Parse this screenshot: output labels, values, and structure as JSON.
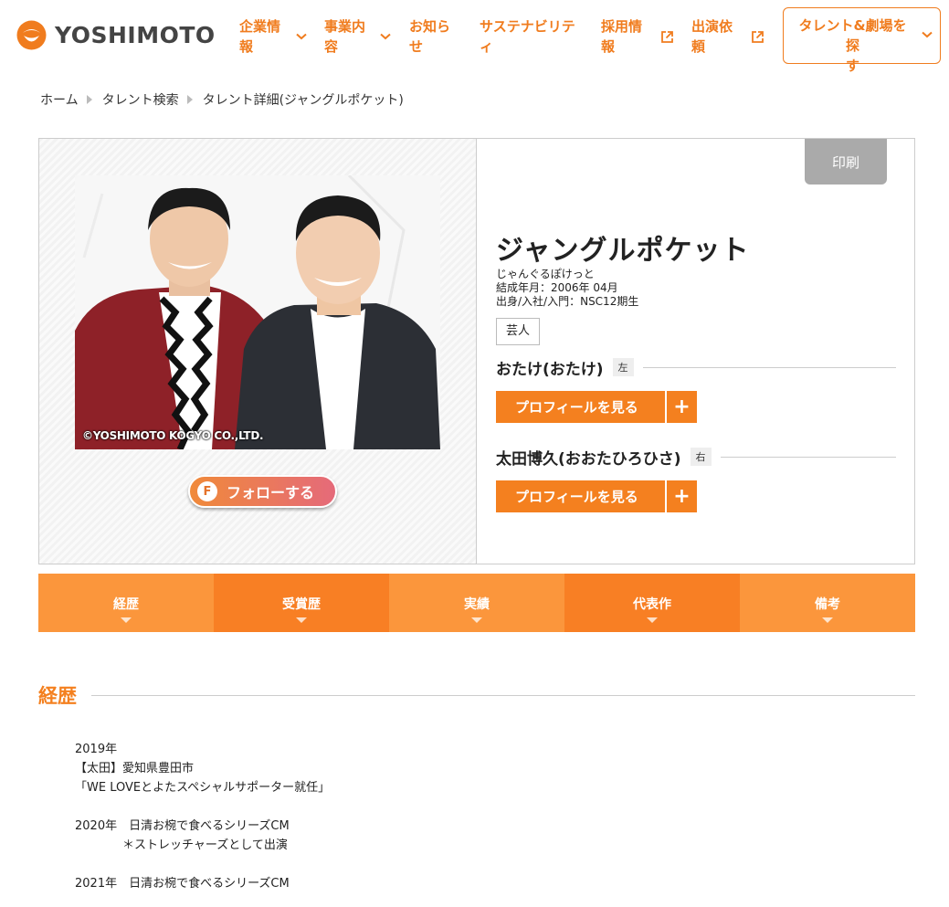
{
  "header": {
    "logo_text": "YOSHIMOTO",
    "nav": [
      {
        "line1": "企業情",
        "line2": "報",
        "icon": "chevron-down-icon"
      },
      {
        "line1": "事業内",
        "line2": "容",
        "icon": "chevron-down-icon"
      },
      {
        "line1": "お知ら",
        "line2": "せ",
        "icon": ""
      },
      {
        "line1": "サステナビリテ",
        "line2": "ィ",
        "icon": ""
      },
      {
        "line1": "採用情",
        "line2": "報",
        "icon": "external-link-icon"
      },
      {
        "line1": "出演依",
        "line2": "頼",
        "icon": "external-link-icon"
      }
    ],
    "search_button": {
      "line1": "タレント&劇場を探",
      "line2": "す"
    },
    "accent_color": "#f07c1e"
  },
  "breadcrumb": [
    "ホーム",
    "タレント検索",
    "タレント詳細(ジャングルポケット)"
  ],
  "profile": {
    "photo_credit": "©YOSHIMOTO KOGYO CO.,LTD.",
    "follow_label": "フォローする",
    "follow_icon_letter": "F",
    "print_label": "印刷",
    "name": "ジャングルポケット",
    "reading": "じゃんぐるぽけっと",
    "formed": "結成年月：2006年 04月",
    "origin": "出身/入社/入門：NSC12期生",
    "tag": "芸人",
    "members": [
      {
        "name": "おたけ(おたけ)",
        "position": "左",
        "button": "プロフィールを見る"
      },
      {
        "name": "太田博久(おおたひろひさ)",
        "position": "右",
        "button": "プロフィールを見る"
      }
    ]
  },
  "tabs": [
    "経歴",
    "受賞歴",
    "実績",
    "代表作",
    "備考"
  ],
  "section": {
    "title": "経歴",
    "lines": [
      "2019年",
      "【太田】愛知県豊田市",
      "「WE LOVEとよたスペシャルサポーター就任」",
      "",
      "2020年　日清お椀で食べるシリーズCM",
      "　　　　＊ストレッチャーズとして出演",
      "",
      "2021年　日清お椀で食べるシリーズCM"
    ]
  }
}
